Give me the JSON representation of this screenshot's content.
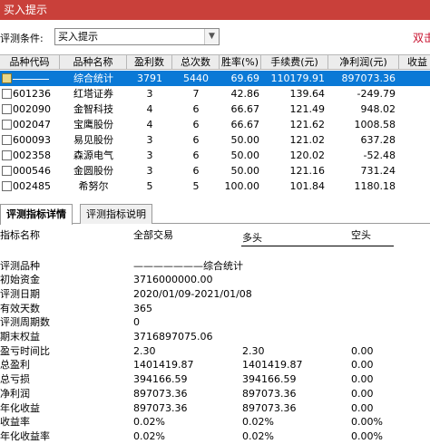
{
  "window": {
    "title": "买入提示"
  },
  "filter": {
    "label": "评测条件:",
    "value": "买入提示",
    "run_label": "双击"
  },
  "grid": {
    "headers": [
      "品种代码",
      "品种名称",
      "盈利数",
      "总次数",
      "胜率(%)",
      "手续费(元)",
      "净利润(元)",
      "收益"
    ],
    "summary": {
      "name": "综合统计",
      "win": "3791",
      "total": "5440",
      "rate": "69.69",
      "fee": "110179.91",
      "pnl": "897073.36"
    },
    "rows": [
      {
        "code": "601236",
        "name": "红塔证券",
        "win": "3",
        "total": "7",
        "rate": "42.86",
        "fee": "139.64",
        "pnl": "-249.79"
      },
      {
        "code": "002090",
        "name": "金智科技",
        "win": "4",
        "total": "6",
        "rate": "66.67",
        "fee": "121.49",
        "pnl": "948.02"
      },
      {
        "code": "002047",
        "name": "宝鹰股份",
        "win": "4",
        "total": "6",
        "rate": "66.67",
        "fee": "121.62",
        "pnl": "1008.58"
      },
      {
        "code": "600093",
        "name": "易见股份",
        "win": "3",
        "total": "6",
        "rate": "50.00",
        "fee": "121.02",
        "pnl": "637.28"
      },
      {
        "code": "002358",
        "name": "森源电气",
        "win": "3",
        "total": "6",
        "rate": "50.00",
        "fee": "120.02",
        "pnl": "-52.48"
      },
      {
        "code": "000546",
        "name": "金圆股份",
        "win": "3",
        "total": "6",
        "rate": "50.00",
        "fee": "121.16",
        "pnl": "731.24"
      },
      {
        "code": "002485",
        "name": "希努尔",
        "win": "5",
        "total": "5",
        "rate": "100.00",
        "fee": "101.84",
        "pnl": "1180.18"
      }
    ]
  },
  "tabs": [
    {
      "label": "评测指标详情"
    },
    {
      "label": "评测指标说明"
    }
  ],
  "report": {
    "headers": {
      "name": "指标名称",
      "all": "全部交易",
      "long": "多头",
      "short": "空头"
    },
    "rows": [
      {
        "label": "评测品种",
        "v1": "———————综合统计",
        "v2": "",
        "v3": ""
      },
      {
        "label": "初始资金",
        "v1": "3716000000.00",
        "v2": "",
        "v3": ""
      },
      {
        "label": "评测日期",
        "v1": "2020/01/09-2021/01/08",
        "v2": "",
        "v3": ""
      },
      {
        "label": "有效天数",
        "v1": "365",
        "v2": "",
        "v3": ""
      },
      {
        "label": "评测周期数",
        "v1": "0",
        "v2": "",
        "v3": ""
      },
      {
        "label": "期末权益",
        "v1": "3716897075.06",
        "v2": "",
        "v3": ""
      },
      {
        "label": "盈亏时间比",
        "v1": "2.30",
        "v2": "2.30",
        "v3": "0.00"
      },
      {
        "label": "总盈利",
        "v1": "1401419.87",
        "v2": "1401419.87",
        "v3": "0.00"
      },
      {
        "label": "总亏损",
        "v1": "394166.59",
        "v2": "394166.59",
        "v3": "0.00"
      },
      {
        "label": "净利润",
        "v1": "897073.36",
        "v2": "897073.36",
        "v3": "0.00"
      },
      {
        "label": "年化收益",
        "v1": "897073.36",
        "v2": "897073.36",
        "v3": "0.00"
      },
      {
        "label": "收益率",
        "v1": "0.02%",
        "v2": "0.02%",
        "v3": "0.00%"
      },
      {
        "label": "年化收益率",
        "v1": "0.02%",
        "v2": "0.02%",
        "v3": "0.00%"
      }
    ]
  },
  "colors": {
    "title_bar": "#c9403a",
    "selection": "#0a79d6",
    "run_link": "#c8102e"
  }
}
